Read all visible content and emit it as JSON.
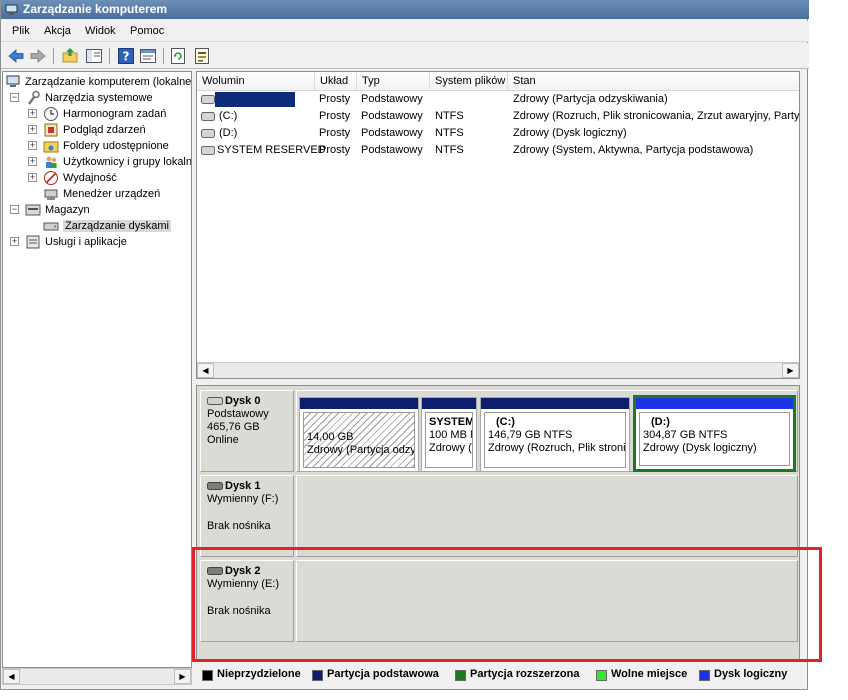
{
  "window": {
    "title": "Zarządzanie komputerem"
  },
  "menu": [
    "Plik",
    "Akcja",
    "Widok",
    "Pomoc"
  ],
  "tree": {
    "root": "Zarządzanie komputerem (lokalne)",
    "system_tools": "Narzędzia systemowe",
    "task_scheduler": "Harmonogram zadań",
    "event_viewer": "Podgląd zdarzeń",
    "shared_folders": "Foldery udostępnione",
    "users_groups": "Użytkownicy i grupy lokalne",
    "performance": "Wydajność",
    "device_manager": "Menedżer urządzeń",
    "storage": "Magazyn",
    "disk_management": "Zarządzanie dyskami",
    "services_apps": "Usługi i aplikacje"
  },
  "volumes": {
    "headers": [
      "Wolumin",
      "Układ",
      "Typ",
      "System plików",
      "Stan"
    ],
    "rows": [
      {
        "name": "",
        "layout": "Prosty",
        "type": "Podstawowy",
        "fs": "",
        "status": "Zdrowy (Partycja odzyskiwania)"
      },
      {
        "name": "(C:)",
        "layout": "Prosty",
        "type": "Podstawowy",
        "fs": "NTFS",
        "status": "Zdrowy (Rozruch, Plik stronicowania, Zrzut awaryjny, Party"
      },
      {
        "name": "(D:)",
        "layout": "Prosty",
        "type": "Podstawowy",
        "fs": "NTFS",
        "status": "Zdrowy (Dysk logiczny)"
      },
      {
        "name": "SYSTEM RESERVED",
        "layout": "Prosty",
        "type": "Podstawowy",
        "fs": "NTFS",
        "status": "Zdrowy (System, Aktywna, Partycja podstawowa)"
      }
    ]
  },
  "disks": {
    "disk0": {
      "name": "Dysk 0",
      "type": "Podstawowy",
      "size": "465,76 GB",
      "state": "Online",
      "partitions": [
        {
          "title": "",
          "size": "14,00 GB",
          "status": "Zdrowy (Partycja odzy"
        },
        {
          "title": "SYSTEM",
          "size": "100 MB N",
          "status": "Zdrowy ("
        },
        {
          "title": "(C:)",
          "size": "146,79 GB NTFS",
          "status": "Zdrowy (Rozruch, Plik stronic"
        },
        {
          "title": "(D:)",
          "size": "304,87 GB NTFS",
          "status": "Zdrowy (Dysk logiczny)"
        }
      ]
    },
    "disk1": {
      "name": "Dysk 1",
      "type": "Wymienny (F:)",
      "state": "Brak nośnika"
    },
    "disk2": {
      "name": "Dysk 2",
      "type": "Wymienny (E:)",
      "state": "Brak nośnika"
    }
  },
  "legend": [
    {
      "label": "Nieprzydzielone",
      "color": "#000000"
    },
    {
      "label": "Partycja podstawowa",
      "color": "#0e1e6e"
    },
    {
      "label": "Partycja rozszerzona",
      "color": "#1b7a1b"
    },
    {
      "label": "Wolne miejsce",
      "color": "#33e633"
    },
    {
      "label": "Dysk logiczny",
      "color": "#1c33e6"
    }
  ],
  "icons": {
    "back": "back-arrow-icon",
    "forward": "forward-arrow-icon",
    "up": "up-folder-icon",
    "console_tree": "console-tree-icon",
    "help": "help-icon",
    "properties": "properties-icon",
    "refresh": "refresh-icon",
    "export": "export-icon"
  }
}
